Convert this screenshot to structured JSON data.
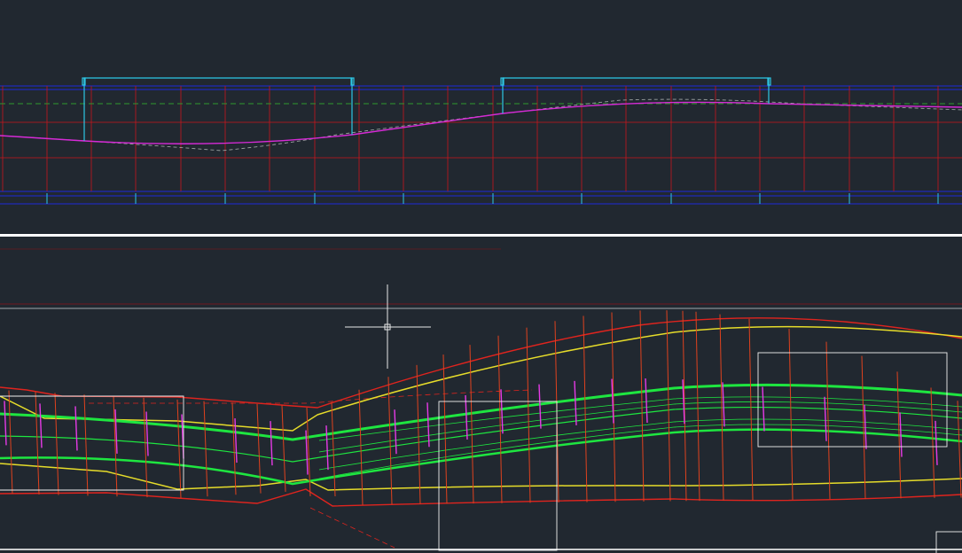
{
  "viewports": {
    "profile": {
      "name": "profile-viewport"
    },
    "plan": {
      "name": "plan-viewport"
    }
  },
  "profile": {
    "curve_labels": [
      "",
      ""
    ],
    "station_labels": [
      "",
      "",
      "",
      "",
      "",
      "",
      "",
      "",
      "",
      "",
      ""
    ]
  },
  "colors": {
    "background": "#212830",
    "profile_border": "#1f2ab8",
    "grid_red": "#c8161c",
    "design_line": "#d62ad6",
    "ground_line": "#9aa0a0",
    "reference_line": "#2e9a2e",
    "curve_marker": "#2ec8e6",
    "plan_outline": "#e0241e",
    "plan_section": "#e0421e",
    "centerline": "#1ee640",
    "edge_line": "#e6dc2a",
    "offset_line": "#e63ae6",
    "viewport_divider": "#ffffff",
    "crosshair": "#e8e8e8"
  },
  "cursor": {
    "type": "crosshair",
    "icon": "crosshair-pickbox-icon"
  }
}
